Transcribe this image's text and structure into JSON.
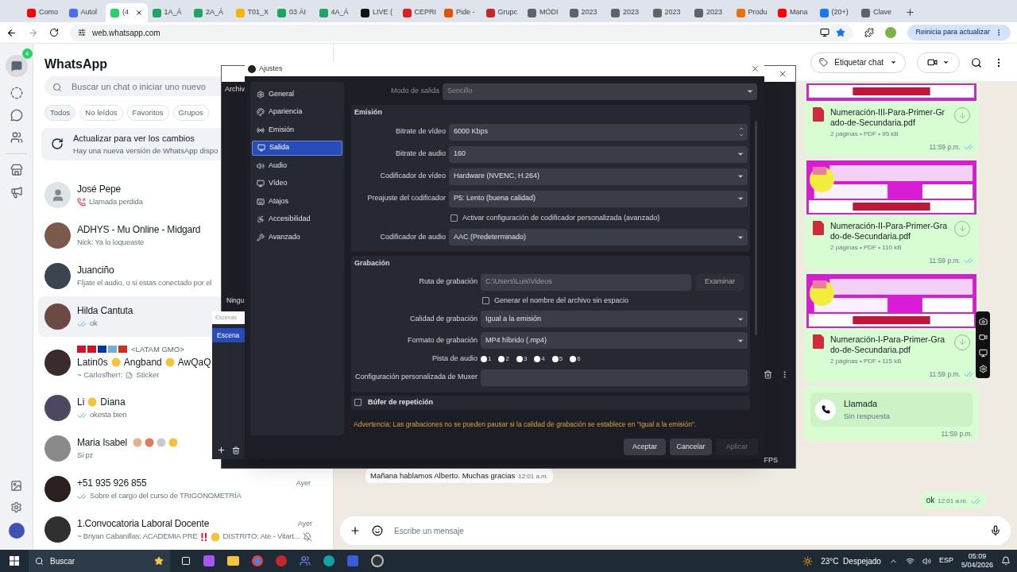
{
  "browser": {
    "tabs": [
      {
        "label": "Como",
        "color": "#ff0000",
        "selected": false
      },
      {
        "label": "Autol",
        "color": "#4a6cf7",
        "selected": false
      },
      {
        "label": "(4",
        "color": "#25d366",
        "selected": true
      },
      {
        "label": "1A_Á",
        "color": "#1fa463",
        "selected": false
      },
      {
        "label": "2A_Á",
        "color": "#1fa463",
        "selected": false
      },
      {
        "label": "T01_X",
        "color": "#f4b400",
        "selected": false
      },
      {
        "label": "03 ÁI",
        "color": "#1fa463",
        "selected": false
      },
      {
        "label": "4A_Á",
        "color": "#1fa463",
        "selected": false
      },
      {
        "label": "LIVE (",
        "color": "#111111",
        "selected": false
      },
      {
        "label": "CEPRI",
        "color": "#e02020",
        "selected": false
      },
      {
        "label": "Pide -",
        "color": "#e65100",
        "selected": false
      },
      {
        "label": "Grupc",
        "color": "#c62828",
        "selected": false
      },
      {
        "label": "MÓDI",
        "color": "#5f6368",
        "selected": false
      },
      {
        "label": "2023",
        "color": "#5f6368",
        "selected": false
      },
      {
        "label": "2023",
        "color": "#5f6368",
        "selected": false
      },
      {
        "label": "2023",
        "color": "#5f6368",
        "selected": false
      },
      {
        "label": "2023",
        "color": "#5f6368",
        "selected": false
      },
      {
        "label": "Produ",
        "color": "#e8710a",
        "selected": false
      },
      {
        "label": "Mana",
        "color": "#ff0000",
        "selected": false
      },
      {
        "label": "(20+)",
        "color": "#1877f2",
        "selected": false
      },
      {
        "label": "Clave",
        "color": "#5f6368",
        "selected": false
      }
    ],
    "address": "web.whatsapp.com",
    "update_button": "Reinicia para actualizar"
  },
  "rail": {
    "chats_badge": "4"
  },
  "sidebar": {
    "title": "WhatsApp",
    "search": {
      "placeholder": "Buscar un chat o iniciar uno nuevo"
    },
    "filters": [
      {
        "label": "Todos",
        "selected": true
      },
      {
        "label": "No leídos",
        "selected": false
      },
      {
        "label": "Favoritos",
        "selected": false
      },
      {
        "label": "Grupos",
        "selected": false
      }
    ],
    "banner": {
      "title": "Actualizar para ver los cambios",
      "text": "Hay una nueva versión de WhatsApp dispo"
    },
    "chats": [
      {
        "kind": "contact",
        "name": "José Pepe",
        "preview": "Llamada perdida",
        "missed_call": true,
        "selected": false
      },
      {
        "name": "ADHYS - Mu Online - Midgard",
        "preview": "Nick: Ya lo loqueaste",
        "color": "#7a5a4a",
        "selected": false
      },
      {
        "name": "Juanciño",
        "preview": "Fíjate el audio, o si estas conectado por el",
        "color": "#3b4550",
        "selected": false
      },
      {
        "name": "Hilda Cantuta",
        "preview": "ok",
        "read": true,
        "color": "#6b4a44",
        "selected": true
      },
      {
        "kind": "group",
        "title": "<LATAM GMO>",
        "words": [
          "Latin0s",
          "Angband",
          "AwQaQ"
        ],
        "preview": "~ Carlosfher!:",
        "sticker": "Sticker",
        "color": "#3a2c2c",
        "selected": false
      },
      {
        "name_parts": [
          "Li",
          "Diana"
        ],
        "preview": "okesta bien",
        "read": true,
        "color": "#4d4860",
        "selected": false
      },
      {
        "name": "Maria Isabel",
        "emojis": true,
        "preview": "Si pz",
        "color": "#8a8a8a",
        "selected": false
      },
      {
        "name": "+51 935 926 855",
        "time": "Ayer",
        "preview": "Sobre el cargo del curso de TRIGONOMETRÍA",
        "read": false,
        "color": "#2a2020",
        "selected": false
      },
      {
        "name": "1.Convocatoria Laboral Docente",
        "time": "Ayer",
        "preview": "~ Briyan Cabanillas: ACADEMIA PRE",
        "preview_tail": "DISTRITO: Ate - Vitart...",
        "muted": true,
        "color": "#303030",
        "selected": false
      }
    ]
  },
  "chat": {
    "label_button": "Etiquetar chat",
    "documents": [
      {
        "file": "Numeración-III-Para-Primer-Grado-de-Secundaria.pdf",
        "meta": "2 páginas • PDF • 95 kB",
        "time": "11:59 p.m.",
        "image_cut": true
      },
      {
        "file": "Numeración-II-Para-Primer-Grado-de-Secundaria.pdf",
        "meta": "2 páginas • PDF • 110 kB",
        "time": "11:59 p.m.",
        "image_cut": false
      },
      {
        "file": "Numeración-I-Para-Primer-Grado-de-Secundaria.pdf",
        "meta": "2 páginas • PDF • 115 kB",
        "time": "11:59 p.m.",
        "image_cut": false
      }
    ],
    "call": {
      "title": "Llamada",
      "status": "Sin respuesta",
      "time": "11:59 p.m."
    },
    "incoming": {
      "text": "Mañana hablamos Alberto. Muchas gracias",
      "time": "12:01 a.m."
    },
    "outgoing": {
      "text": "ok",
      "time": "12:01 a.m.",
      "read": true
    },
    "composer": {
      "placeholder": "Escribe un mensaje"
    }
  },
  "obs": {
    "menu": "Archiv",
    "scenes_label": "Ningu",
    "dock_tab": "Escenas",
    "scene": {
      "label": "Escena",
      "selected": true
    },
    "fps": "FPS"
  },
  "settings": {
    "title": "Ajustes",
    "nav": [
      {
        "label": "General",
        "selected": false
      },
      {
        "label": "Apariencia",
        "selected": false
      },
      {
        "label": "Emisión",
        "selected": false
      },
      {
        "label": "Salida",
        "selected": true
      },
      {
        "label": "Audio",
        "selected": false
      },
      {
        "label": "Vídeo",
        "selected": false
      },
      {
        "label": "Atajos",
        "selected": false
      },
      {
        "label": "Accesibilidad",
        "selected": false
      },
      {
        "label": "Avanzado",
        "selected": false
      }
    ],
    "mode": {
      "label": "Modo de salida",
      "value": "Sencillo",
      "disabled": true
    },
    "groups": [
      {
        "title": "Emisión",
        "rows": [
          {
            "kind": "spin",
            "label": "Bitrate de vídeo",
            "value": "6000 Kbps"
          },
          {
            "kind": "select",
            "label": "Bitrate de audio",
            "value": "160"
          },
          {
            "kind": "select",
            "label": "Codificador de vídeo",
            "value": "Hardware (NVENC, H.264)"
          },
          {
            "kind": "select",
            "label": "Preajuste del codificador",
            "value": "P5: Lento (buena calidad)"
          },
          {
            "kind": "checkbox",
            "label": "Activar configuración de codificador personalizada (avanzado)",
            "checked": false
          },
          {
            "kind": "select",
            "label": "Codificador de audio",
            "value": "AAC (Predeterminado)"
          }
        ]
      },
      {
        "title": "Grabación",
        "rows": [
          {
            "kind": "path",
            "label": "Ruta de grabación",
            "value": "C:\\Users\\Luis\\Videos",
            "button": "Examinar"
          },
          {
            "kind": "checkbox",
            "label": "Generar el nombre del archivo sin espacio",
            "checked": false
          },
          {
            "kind": "select",
            "label": "Calidad de grabación",
            "value": "Igual a la emisión"
          },
          {
            "kind": "select",
            "label": "Formato de grabación",
            "value": "MP4 híbrido (.mp4)"
          },
          {
            "kind": "tracks",
            "label": "Pista de audio",
            "tracks": [
              {
                "label": "1"
              },
              {
                "label": "2"
              },
              {
                "label": "3"
              },
              {
                "label": "4"
              },
              {
                "label": "5"
              },
              {
                "label": "6"
              }
            ]
          },
          {
            "kind": "text",
            "label": "Configuración personalizada de Muxer"
          }
        ]
      }
    ],
    "replay_buffer": {
      "label": "Búfer de repetición",
      "checked": false
    },
    "warning": "Advertencia: Las grabaciones no se pueden pausar si la calidad de grabación se establece en \"Igual a la emisión\".",
    "buttons": [
      {
        "label": "Aceptar",
        "disabled": false
      },
      {
        "label": "Cancelar",
        "disabled": false
      },
      {
        "label": "Aplicar",
        "disabled": true
      }
    ]
  },
  "taskbar": {
    "search": "Buscar",
    "weather": "23°C  Despejado",
    "language": "ESP",
    "time": "05:09",
    "date": "5/04/2026"
  }
}
